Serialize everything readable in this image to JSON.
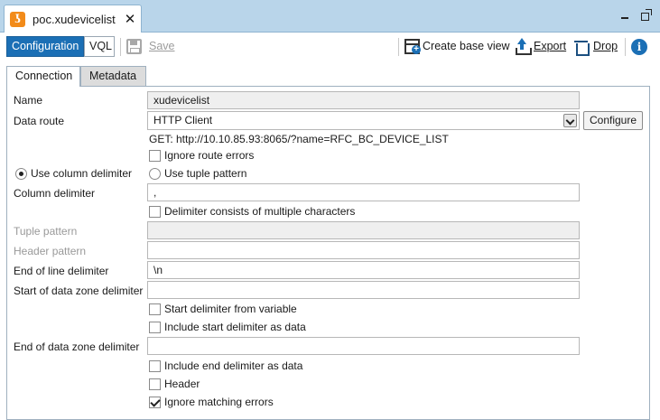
{
  "window": {
    "tab_title": "poc.xudevicelist",
    "close_glyph": "✕",
    "app_icon_glyph": "ʖ",
    "accent_color": "#1b6fb5",
    "tab_bar_color": "#b9d5ea"
  },
  "toolbar": {
    "configuration_label": "Configuration",
    "vql_label": "VQL",
    "save_label": "Save",
    "create_base_view_label": "Create base view",
    "export_label": "Export",
    "drop_label": "Drop",
    "info_glyph": "i"
  },
  "tabs": [
    {
      "label": "Connection",
      "active": true
    },
    {
      "label": "Metadata",
      "active": false
    }
  ],
  "form": {
    "name_label": "Name",
    "name_value": "xudevicelist",
    "data_route_label": "Data route",
    "data_route_value": "HTTP Client",
    "configure_label": "Configure",
    "route_hint": "GET: http://10.10.85.93:8065/?name=RFC_BC_DEVICE_LIST",
    "ignore_route_errors_label": "Ignore route errors",
    "ignore_route_errors_checked": false,
    "use_column_delimiter_label": "Use column delimiter",
    "use_column_delimiter_selected": true,
    "use_tuple_pattern_label": "Use tuple pattern",
    "use_tuple_pattern_selected": false,
    "column_delimiter_label": "Column delimiter",
    "column_delimiter_value": ",",
    "delimiter_multiple_label": "Delimiter consists of multiple characters",
    "delimiter_multiple_checked": false,
    "tuple_pattern_label": "Tuple pattern",
    "tuple_pattern_value": "",
    "header_pattern_label": "Header pattern",
    "header_pattern_value": "",
    "end_of_line_label": "End of line delimiter",
    "end_of_line_value": "\\n",
    "start_data_zone_label": "Start of data zone delimiter",
    "start_data_zone_value": "",
    "start_from_variable_label": "Start delimiter from variable",
    "start_from_variable_checked": false,
    "include_start_label": "Include start delimiter as data",
    "include_start_checked": false,
    "end_data_zone_label": "End of data zone delimiter",
    "end_data_zone_value": "",
    "include_end_label": "Include end delimiter as data",
    "include_end_checked": false,
    "header_label": "Header",
    "header_checked": false,
    "ignore_matching_label": "Ignore matching errors",
    "ignore_matching_checked": true
  }
}
